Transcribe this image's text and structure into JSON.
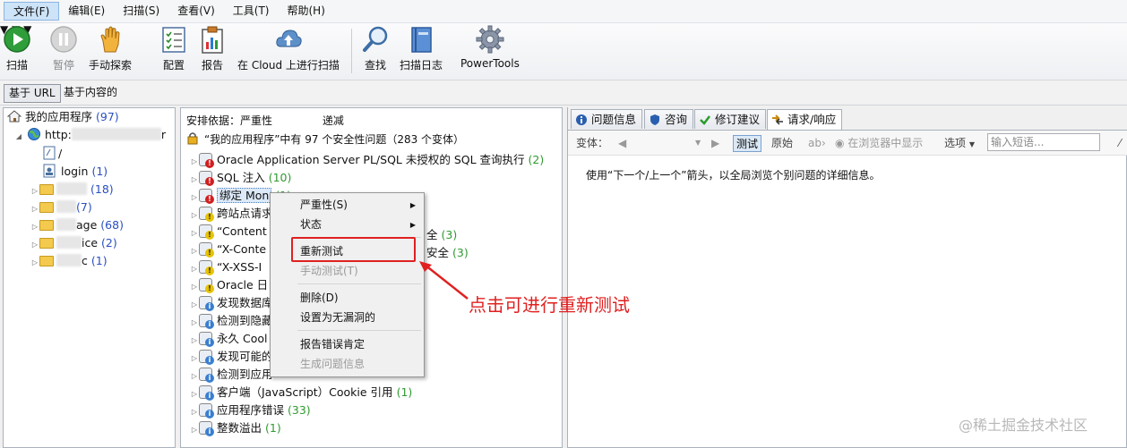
{
  "menubar": {
    "items": [
      "文件(F)",
      "编辑(E)",
      "扫描(S)",
      "查看(V)",
      "工具(T)",
      "帮助(H)"
    ]
  },
  "toolbar": {
    "scan": "扫描",
    "pause": "暂停",
    "manual_explore": "手动探索",
    "config": "配置",
    "report": "报告",
    "cloud_scan": "在 Cloud 上进行扫描",
    "find": "查找",
    "scan_log": "扫描日志",
    "powertools": "PowerTools"
  },
  "view_tabs": {
    "url_based": "基于 URL",
    "content_based": "基于内容的"
  },
  "tree": {
    "root_label": "我的应用程序",
    "root_count": "(97)",
    "host_label": "http:",
    "host_suffix": "r",
    "items": [
      {
        "label": "/",
        "count": ""
      },
      {
        "label": "login",
        "count": "(1)"
      },
      {
        "label": "",
        "count": "(18)"
      },
      {
        "label": "",
        "count": "(7)"
      },
      {
        "label": "age",
        "count": "(68)"
      },
      {
        "label": "ice",
        "count": "(2)"
      },
      {
        "label": "c",
        "count": "(1)"
      }
    ]
  },
  "issues": {
    "sort_label": "安排依据：严重性",
    "sort_order": "递减",
    "summary": "“我的应用程序”中有 97 个安全性问题（283 个变体）",
    "rows": [
      {
        "label": "Oracle Application Server PL/SQL 未授权的 SQL 查询执行",
        "count": "(2)",
        "sev": "high"
      },
      {
        "label": "SQL 注入",
        "count": "(10)",
        "sev": "high"
      },
      {
        "label": "绑定 Mon",
        "count": "(1)",
        "sev": "high",
        "selected": true
      },
      {
        "label": "跨站点请求",
        "count": "",
        "sev": "med"
      },
      {
        "label": "“Content",
        "count": "",
        "sev": "med"
      },
      {
        "label": "“X-Conte",
        "count": "",
        "sev": "med"
      },
      {
        "label": "“X-XSS-I",
        "count": "",
        "sev": "med"
      },
      {
        "label": "Oracle 日",
        "count": "",
        "sev": "med"
      },
      {
        "label": "发现数据库",
        "count": "",
        "sev": "low"
      },
      {
        "label": "检测到隐藏",
        "count": "",
        "sev": "low"
      },
      {
        "label": "永久 Cool",
        "count": "",
        "sev": "low"
      },
      {
        "label": "发现可能的",
        "count": "",
        "sev": "low"
      },
      {
        "label": "检测到应用",
        "count": "",
        "sev": "low"
      },
      {
        "label": "客户端（JavaScript）Cookie 引用",
        "count": "(1)",
        "sev": "low"
      },
      {
        "label": "应用程序错误",
        "count": "(33)",
        "sev": "low"
      },
      {
        "label": "整数溢出",
        "count": "(1)",
        "sev": "low"
      }
    ],
    "right_fragments": [
      "全",
      "(3)",
      "安全",
      "(3)"
    ]
  },
  "context_menu": {
    "severity": "严重性(S)",
    "status": "状态",
    "retest": "重新测试",
    "manual_test": "手动测试(T)",
    "delete": "删除(D)",
    "set_not_vuln": "设置为无漏洞的",
    "report_fp": "报告错误肯定",
    "gen_issue_info": "生成问题信息"
  },
  "detail": {
    "tabs": [
      "问题信息",
      "咨询",
      "修订建议",
      "请求/响应"
    ],
    "variant_label": "变体：",
    "test_btn": "测试",
    "original_btn": "原始",
    "browser_btn": "在浏览器中显示",
    "options_btn": "选项",
    "phrase_placeholder": "输入短语...",
    "message": "使用“下一个/上一个”箭头，以全局浏览个别问题的详细信息。"
  },
  "annotation": {
    "callout": "点击可进行重新测试",
    "watermark": "@稀土掘金技术社区",
    "color": "#e02020"
  }
}
